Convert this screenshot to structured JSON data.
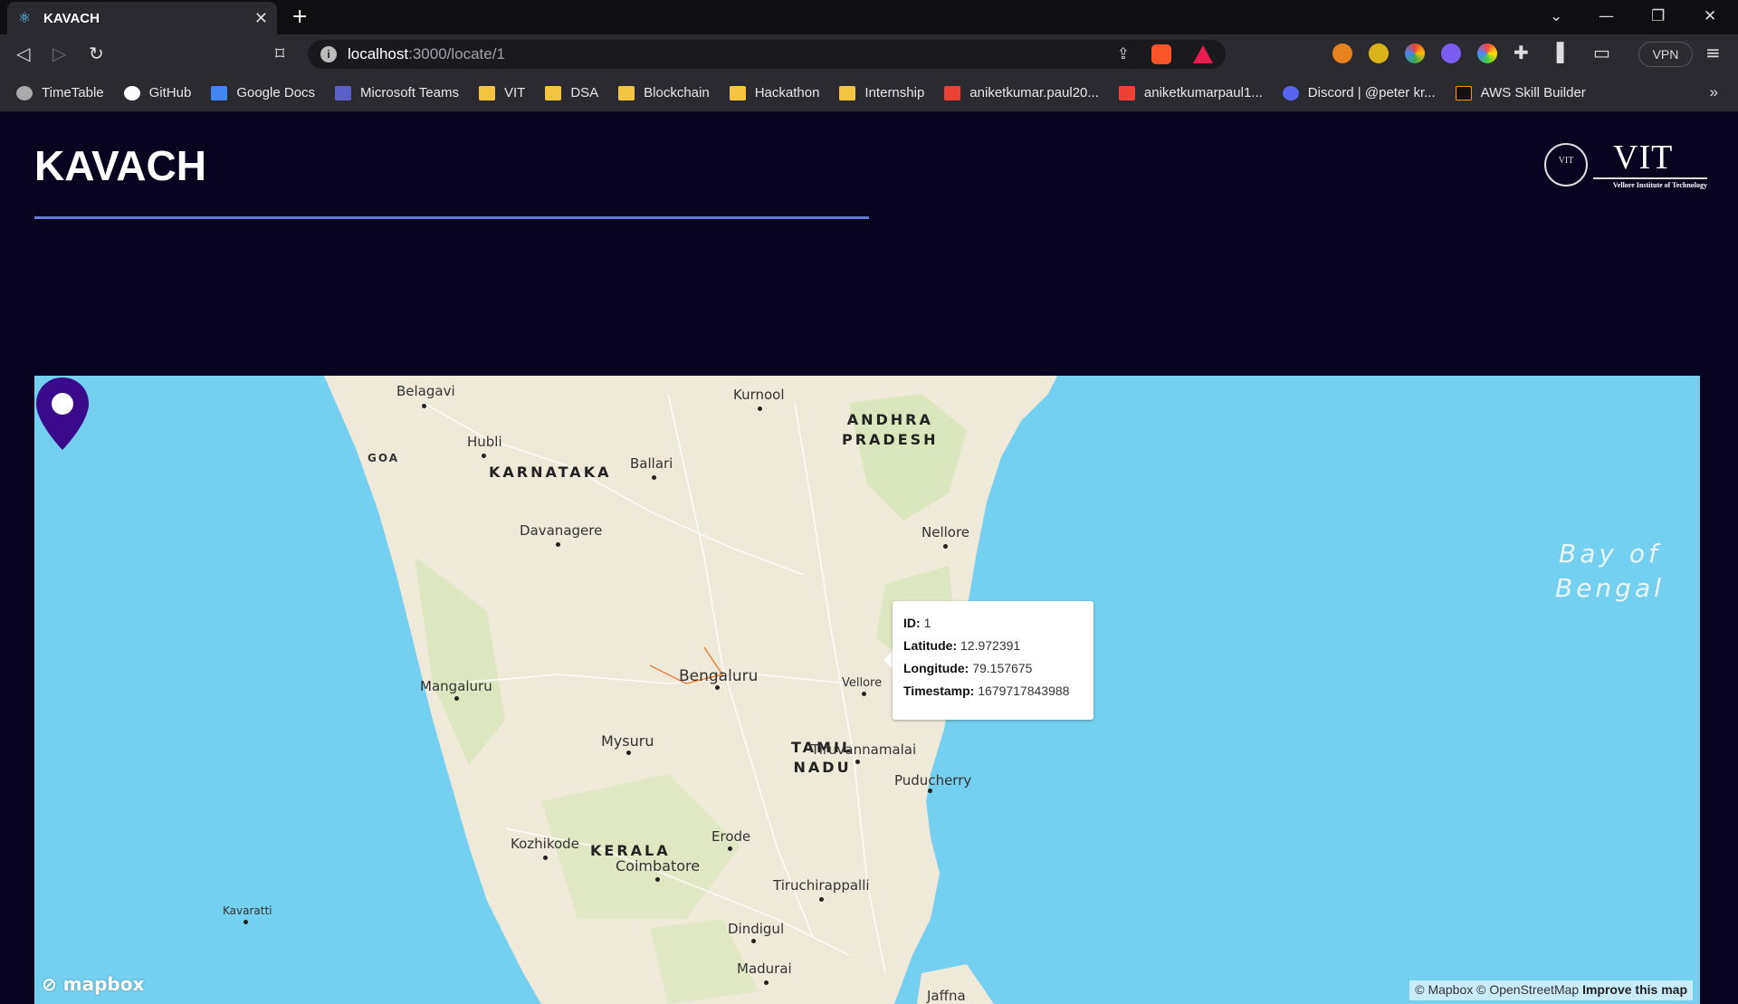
{
  "browser": {
    "tab_title": "KAVACH",
    "url_host": "localhost",
    "url_path": ":3000/locate/1",
    "vpn_label": "VPN",
    "bookmarks": [
      {
        "label": "TimeTable",
        "icon": "globe-icon"
      },
      {
        "label": "GitHub",
        "icon": "github-icon"
      },
      {
        "label": "Google Docs",
        "icon": "docs-icon"
      },
      {
        "label": "Microsoft Teams",
        "icon": "teams-icon"
      },
      {
        "label": "VIT",
        "icon": "folder-icon"
      },
      {
        "label": "DSA",
        "icon": "folder-icon"
      },
      {
        "label": "Blockchain",
        "icon": "folder-icon"
      },
      {
        "label": "Hackathon",
        "icon": "folder-icon"
      },
      {
        "label": "Internship",
        "icon": "folder-icon"
      },
      {
        "label": "aniketkumar.paul20...",
        "icon": "gmail-icon"
      },
      {
        "label": "aniketkumarpaul1...",
        "icon": "gmail-icon"
      },
      {
        "label": "Discord | @peter kr...",
        "icon": "discord-icon"
      },
      {
        "label": "AWS Skill Builder",
        "icon": "aws-icon"
      }
    ],
    "more": "»"
  },
  "app": {
    "title": "KAVACH",
    "logo": {
      "wordmark": "VIT",
      "subtitle": "Vellore Institute of Technology",
      "seal": "VIT"
    }
  },
  "map": {
    "places": [
      "Belagavi",
      "Hubli",
      "GOA",
      "Kurnool",
      "Ballari",
      "Davanagere",
      "Nellore",
      "Mangaluru",
      "Bengaluru",
      "Mysuru",
      "Tiruvannamalai",
      "Puducherry",
      "Kozhikode",
      "Erode",
      "Coimbatore",
      "Tiruchirappalli",
      "Kavaratti",
      "Dindigul",
      "Madurai",
      "Jaffna",
      "Vellore"
    ],
    "states": {
      "karnataka": "KARNATAKA",
      "andhra_1": "ANDHRA",
      "andhra_2": "PRADESH",
      "tamil_1": "TAMIL",
      "tamil_2": "NADU",
      "kerala": "KERALA"
    },
    "sea": {
      "line1": "Bay of",
      "line2": "Bengal"
    },
    "popup": {
      "id_label": "ID:",
      "id_value": "1",
      "lat_label": "Latitude:",
      "lat_value": "12.972391",
      "lon_label": "Longitude:",
      "lon_value": "79.157675",
      "ts_label": "Timestamp:",
      "ts_value": "1679717843988"
    },
    "brand": "mapbox",
    "attribution": "© Mapbox © OpenStreetMap",
    "improve": "Improve this map",
    "colors": {
      "land": "#efe9da",
      "water": "#75cff0",
      "park": "#d4e6b5",
      "marker": "#3a0a8c"
    }
  }
}
